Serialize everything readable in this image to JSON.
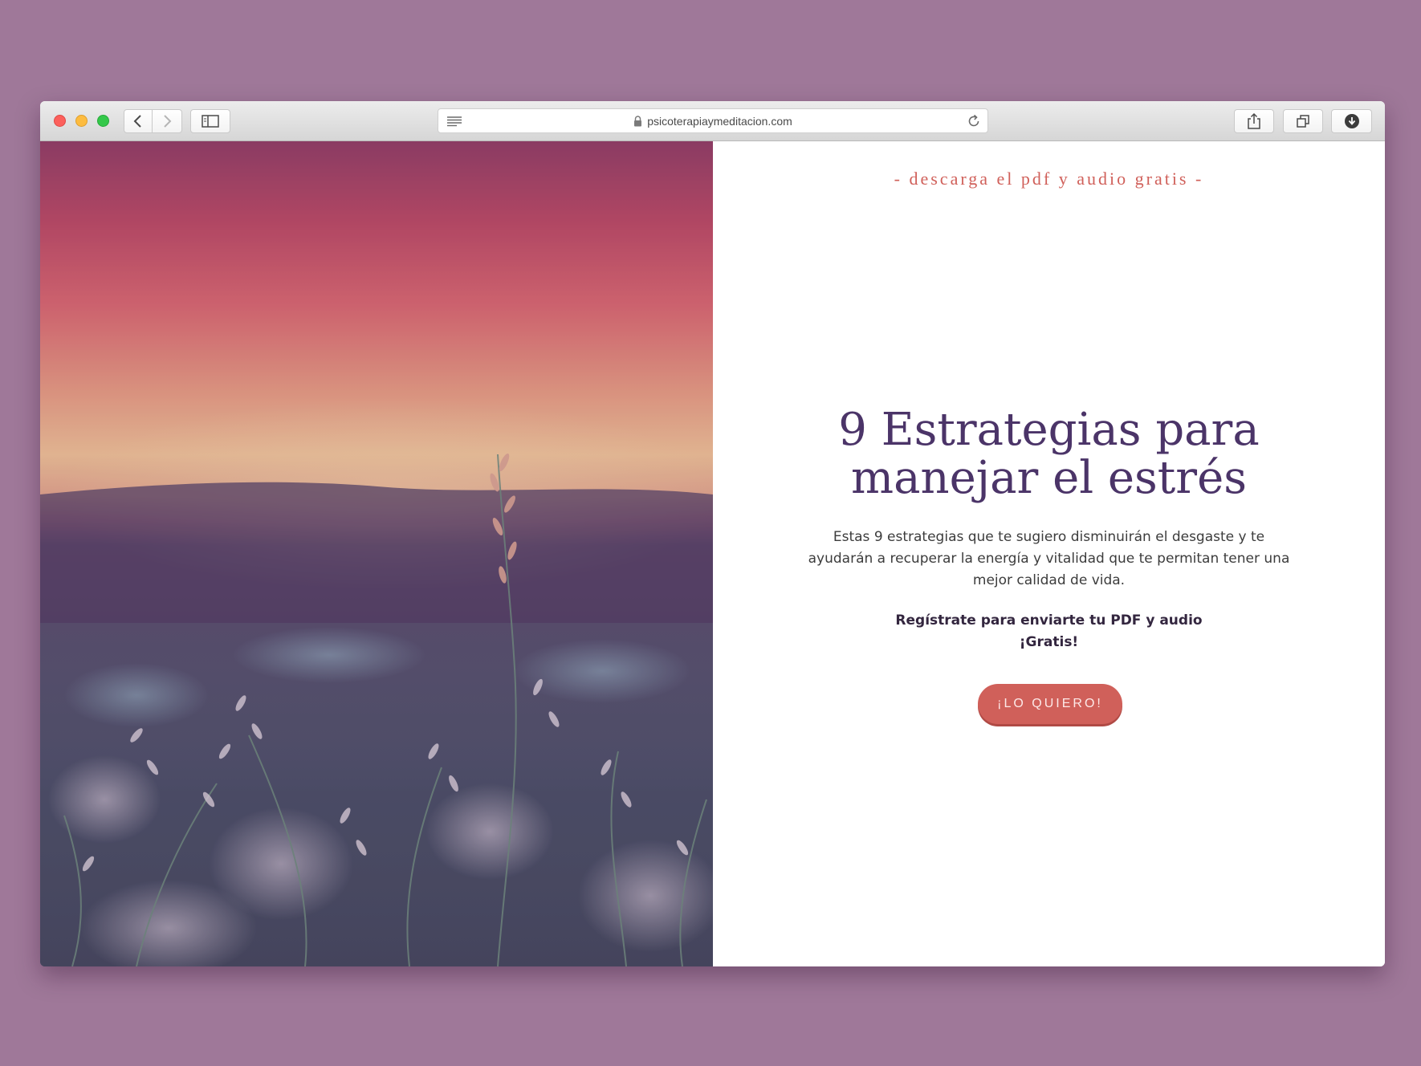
{
  "browser": {
    "url": "psicoterapiaymeditacion.com"
  },
  "page": {
    "eyebrow": "- descarga el pdf y audio gratis -",
    "headline_line1": "9 Estrategias para",
    "headline_line2": "manejar el estrés",
    "description_line1": "Estas 9 estrategias que te sugiero  disminuirán el desgaste y te",
    "description_line2": "ayudarán a recuperar la energía y vitalidad que te permitan tener una",
    "description_line3": "mejor calidad de vida.",
    "cta_line1": "Regístrate para enviarte tu PDF y audio",
    "cta_line2": "¡Gratis!",
    "button_label": "¡LO QUIERO!"
  },
  "colors": {
    "background": "#9f7899",
    "accent": "#d0605a",
    "headline": "#4b3468",
    "body_text": "#3c3c3c"
  },
  "icons": {
    "back": "chevron-left-icon",
    "forward": "chevron-right-icon",
    "sidebar": "sidebar-icon",
    "reader": "reader-mode-icon",
    "lock": "lock-icon",
    "reload": "reload-icon",
    "share": "share-icon",
    "tabs": "tabs-icon",
    "download": "download-icon"
  }
}
